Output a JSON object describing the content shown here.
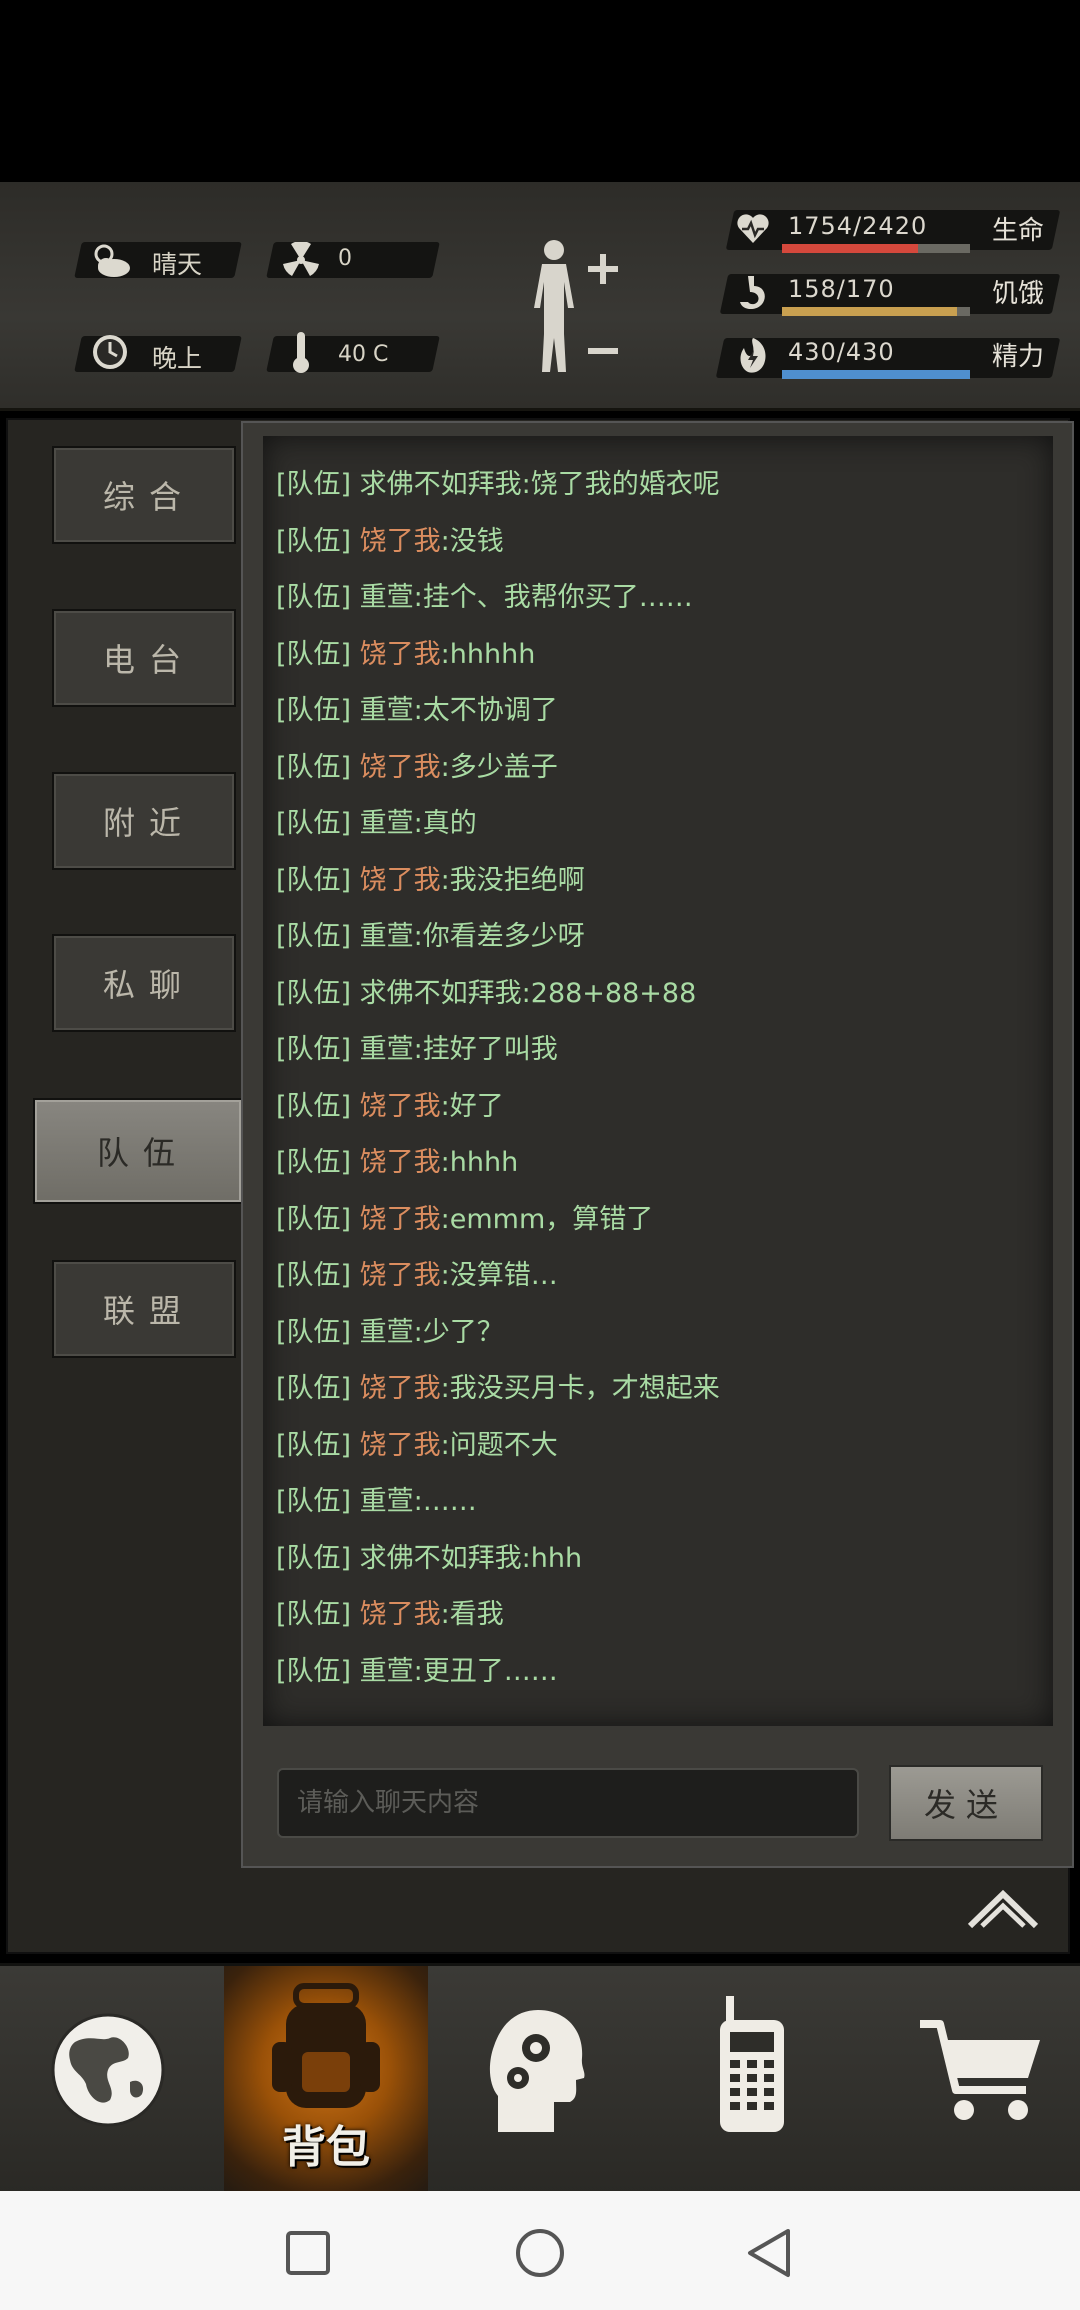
{
  "status": {
    "weather": "晴天",
    "radiation": "0",
    "time_of_day": "晚上",
    "temperature": "40 C"
  },
  "stats": {
    "health": {
      "value": "1754/2420",
      "label": "生命",
      "fraction": 0.725,
      "color": "#d5483c"
    },
    "hunger": {
      "value": "158/170",
      "label": "饥饿",
      "fraction": 0.93,
      "color": "#c9a050"
    },
    "energy": {
      "value": "430/430",
      "label": "精力",
      "fraction": 1.0,
      "color": "#4f8fcf"
    }
  },
  "tabs": [
    {
      "label": "综合",
      "active": false
    },
    {
      "label": "电台",
      "active": false
    },
    {
      "label": "附近",
      "active": false
    },
    {
      "label": "私聊",
      "active": false
    },
    {
      "label": "队伍",
      "active": true
    },
    {
      "label": "联盟",
      "active": false
    }
  ],
  "messages": [
    {
      "channel": "[队伍]",
      "name": "求佛不如拜我",
      "text": ":饶了我的婚衣呢",
      "orange": false
    },
    {
      "channel": "[队伍]",
      "name": "饶了我",
      "text": ":没钱",
      "orange": true
    },
    {
      "channel": "[队伍]",
      "name": "重萱",
      "text": ":挂个、我帮你买了……",
      "orange": false
    },
    {
      "channel": "[队伍]",
      "name": "饶了我",
      "text": ":hhhhh",
      "orange": true
    },
    {
      "channel": "[队伍]",
      "name": "重萱",
      "text": ":太不协调了",
      "orange": false
    },
    {
      "channel": "[队伍]",
      "name": "饶了我",
      "text": ":多少盖子",
      "orange": true
    },
    {
      "channel": "[队伍]",
      "name": "重萱",
      "text": ":真的",
      "orange": false
    },
    {
      "channel": "[队伍]",
      "name": "饶了我",
      "text": ":我没拒绝啊",
      "orange": true
    },
    {
      "channel": "[队伍]",
      "name": "重萱",
      "text": ":你看差多少呀",
      "orange": false
    },
    {
      "channel": "[队伍]",
      "name": "求佛不如拜我",
      "text": ":288+88+88",
      "orange": false
    },
    {
      "channel": "[队伍]",
      "name": "重萱",
      "text": ":挂好了叫我",
      "orange": false
    },
    {
      "channel": "[队伍]",
      "name": "饶了我",
      "text": ":好了",
      "orange": true
    },
    {
      "channel": "[队伍]",
      "name": "饶了我",
      "text": ":hhhh",
      "orange": true
    },
    {
      "channel": "[队伍]",
      "name": "饶了我",
      "text": ":emmm，算错了",
      "orange": true
    },
    {
      "channel": "[队伍]",
      "name": "饶了我",
      "text": ":没算错…",
      "orange": true
    },
    {
      "channel": "[队伍]",
      "name": "重萱",
      "text": ":少了？",
      "orange": false
    },
    {
      "channel": "[队伍]",
      "name": "饶了我",
      "text": ":我没买月卡，才想起来",
      "orange": true
    },
    {
      "channel": "[队伍]",
      "name": "饶了我",
      "text": ":问题不大",
      "orange": true
    },
    {
      "channel": "[队伍]",
      "name": "重萱",
      "text": ":……",
      "orange": false
    },
    {
      "channel": "[队伍]",
      "name": "求佛不如拜我",
      "text": ":hhh",
      "orange": false
    },
    {
      "channel": "[队伍]",
      "name": "饶了我",
      "text": ":看我",
      "orange": true
    },
    {
      "channel": "[队伍]",
      "name": "重萱",
      "text": ":更丑了……",
      "orange": false
    }
  ],
  "chat_input": {
    "placeholder": "请输入聊天内容"
  },
  "send_label": "发送",
  "bottom_nav": {
    "items": [
      "globe-icon",
      "backpack-icon",
      "skills-head-icon",
      "radio-icon",
      "cart-icon"
    ],
    "backpack_label": "背包"
  }
}
